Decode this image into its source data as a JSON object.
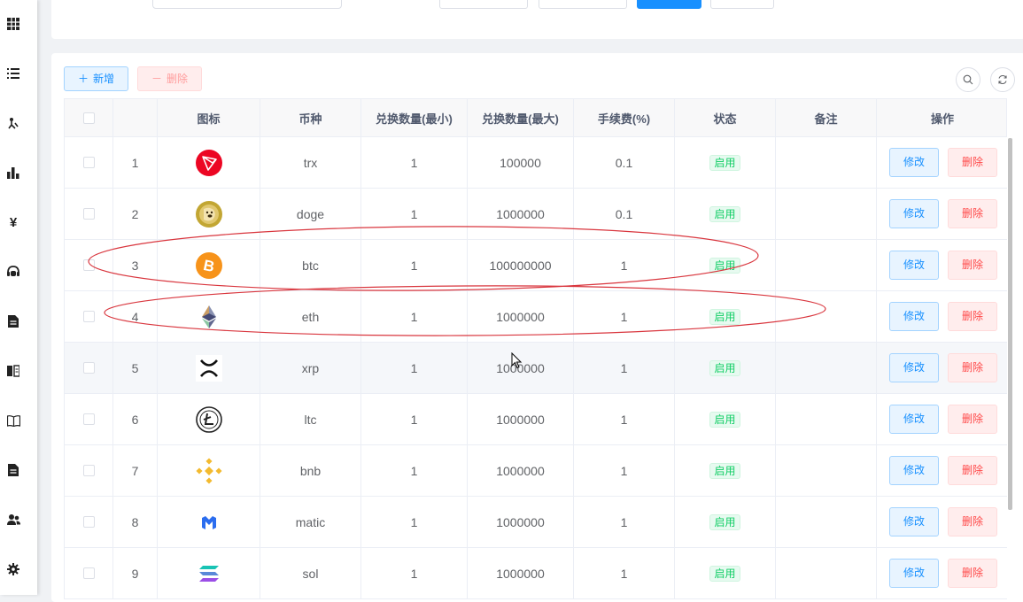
{
  "sidebar": {
    "icons": [
      "table-icon",
      "list-icon",
      "network-icon",
      "chart-icon",
      "yen-icon",
      "service-icon",
      "document-icon",
      "book-icon",
      "open-book-icon",
      "file-icon",
      "users-icon",
      "gear-icon"
    ]
  },
  "toolbar": {
    "add_label": "新增",
    "delete_label": "删除"
  },
  "table": {
    "headers": {
      "icon": "图标",
      "currency": "币种",
      "min": "兑换数量(最小)",
      "max": "兑换数量(最大)",
      "fee": "手续费(%)",
      "status": "状态",
      "remark": "备注",
      "ops": "操作"
    },
    "edit_label": "修改",
    "delete_label": "删除",
    "rows": [
      {
        "no": "1",
        "coin": "trx",
        "min": "1",
        "max": "100000",
        "fee": "0.1",
        "status": "启用",
        "icon": "trx-icon"
      },
      {
        "no": "2",
        "coin": "doge",
        "min": "1",
        "max": "1000000",
        "fee": "0.1",
        "status": "启用",
        "icon": "doge-icon"
      },
      {
        "no": "3",
        "coin": "btc",
        "min": "1",
        "max": "100000000",
        "fee": "1",
        "status": "启用",
        "icon": "btc-icon"
      },
      {
        "no": "4",
        "coin": "eth",
        "min": "1",
        "max": "1000000",
        "fee": "1",
        "status": "启用",
        "icon": "eth-icon"
      },
      {
        "no": "5",
        "coin": "xrp",
        "min": "1",
        "max": "1000000",
        "fee": "1",
        "status": "启用",
        "icon": "xrp-icon"
      },
      {
        "no": "6",
        "coin": "ltc",
        "min": "1",
        "max": "1000000",
        "fee": "1",
        "status": "启用",
        "icon": "ltc-icon"
      },
      {
        "no": "7",
        "coin": "bnb",
        "min": "1",
        "max": "1000000",
        "fee": "1",
        "status": "启用",
        "icon": "bnb-icon"
      },
      {
        "no": "8",
        "coin": "matic",
        "min": "1",
        "max": "1000000",
        "fee": "1",
        "status": "启用",
        "icon": "matic-icon"
      },
      {
        "no": "9",
        "coin": "sol",
        "min": "1",
        "max": "1000000",
        "fee": "1",
        "status": "启用",
        "icon": "sol-icon"
      }
    ]
  },
  "colors": {
    "primary": "#1890ff",
    "danger": "#ff4949",
    "success": "#13ce66",
    "annotation": "#d9363e"
  }
}
